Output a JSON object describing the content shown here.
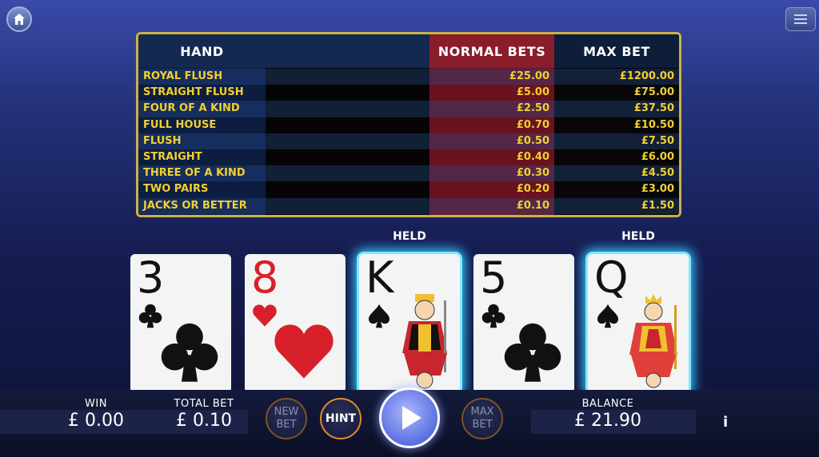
{
  "topbar": {
    "home_icon": "home-icon",
    "menu_icon": "hamburger-menu-icon"
  },
  "paytable": {
    "headers": {
      "hand": "HAND",
      "normal": "NORMAL BETS",
      "max": "MAX BET"
    },
    "rows": [
      {
        "hand": "ROYAL FLUSH",
        "normal": "£25.00",
        "max": "£1200.00"
      },
      {
        "hand": "STRAIGHT FLUSH",
        "normal": "£5.00",
        "max": "£75.00"
      },
      {
        "hand": "FOUR OF A KIND",
        "normal": "£2.50",
        "max": "£37.50"
      },
      {
        "hand": "FULL HOUSE",
        "normal": "£0.70",
        "max": "£10.50"
      },
      {
        "hand": "FLUSH",
        "normal": "£0.50",
        "max": "£7.50"
      },
      {
        "hand": "STRAIGHT",
        "normal": "£0.40",
        "max": "£6.00"
      },
      {
        "hand": "THREE OF A KIND",
        "normal": "£0.30",
        "max": "£4.50"
      },
      {
        "hand": "TWO PAIRS",
        "normal": "£0.20",
        "max": "£3.00"
      },
      {
        "hand": "JACKS OR BETTER",
        "normal": "£0.10",
        "max": "£1.50"
      }
    ]
  },
  "held_label": "HELD",
  "cards": [
    {
      "rank": "3",
      "suit": "clubs",
      "held": false
    },
    {
      "rank": "8",
      "suit": "hearts",
      "held": false
    },
    {
      "rank": "K",
      "suit": "spades",
      "held": true
    },
    {
      "rank": "5",
      "suit": "clubs",
      "held": false
    },
    {
      "rank": "Q",
      "suit": "spades",
      "held": true
    }
  ],
  "bottom": {
    "win_label": "WIN",
    "win_value": "£ 0.00",
    "total_bet_label": "TOTAL BET",
    "total_bet_value": "£ 0.10",
    "new_bet_line1": "NEW",
    "new_bet_line2": "BET",
    "hint_label": "HINT",
    "play_icon": "play-icon",
    "max_bet_line1": "MAX",
    "max_bet_line2": "BET",
    "balance_label": "BALANCE",
    "balance_value": "£ 21.90",
    "info_label": "i"
  },
  "colors": {
    "paytable_text": "#f2d030",
    "held_glow": "#36c8ff",
    "red_suit": "#d8202a",
    "hint_border": "#e08c2a"
  }
}
